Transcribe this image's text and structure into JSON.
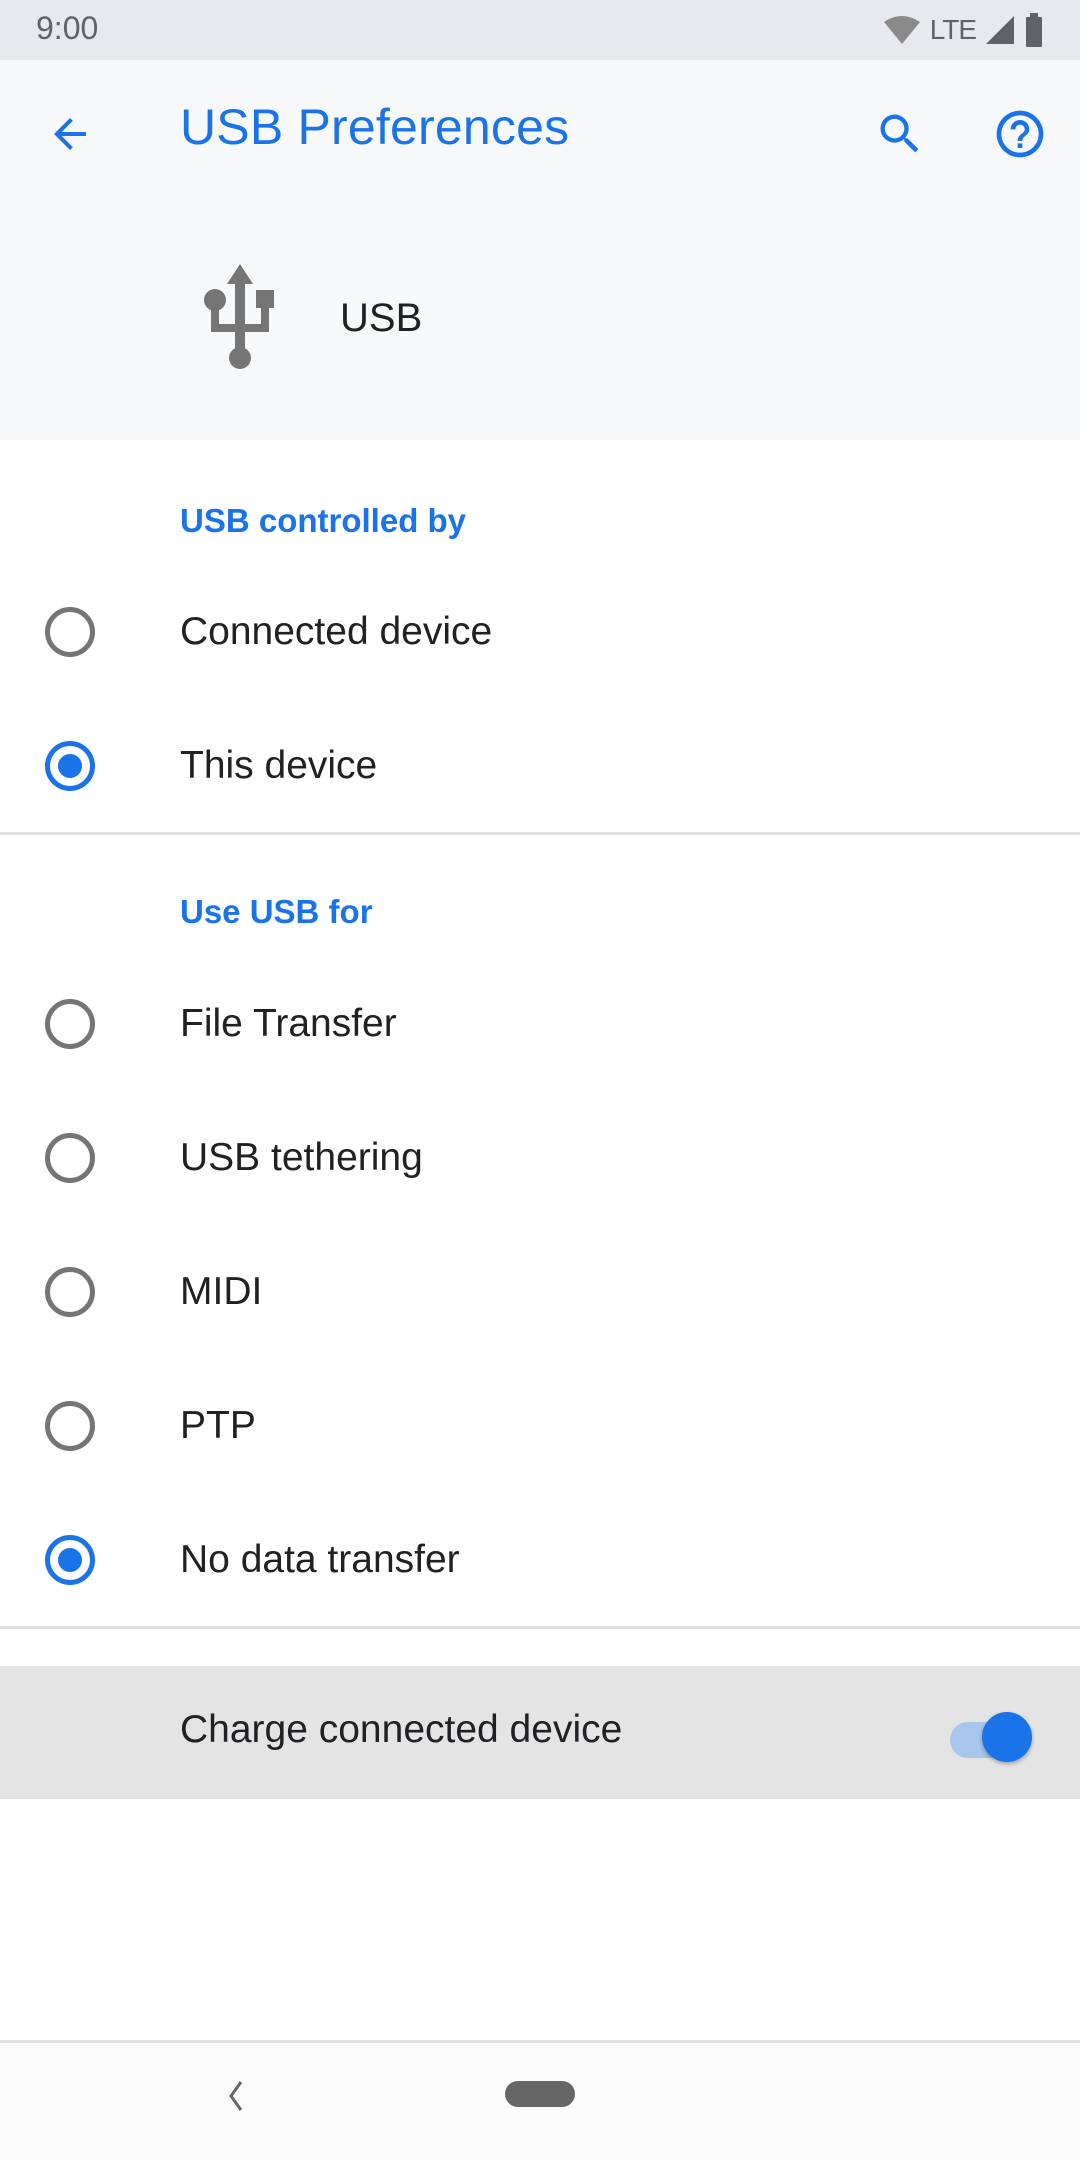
{
  "status_bar": {
    "time": "9:00",
    "network": "LTE",
    "icons": [
      "wifi-icon",
      "lte-text",
      "cell-signal-icon",
      "battery-icon"
    ]
  },
  "app_bar": {
    "title": "USB Preferences",
    "back_icon": "arrow-back-icon",
    "search_icon": "search-icon",
    "help_icon": "help-icon"
  },
  "header": {
    "icon": "usb-icon",
    "label": "USB"
  },
  "sections": [
    {
      "title": "USB controlled by",
      "options": [
        {
          "label": "Connected device",
          "checked": false
        },
        {
          "label": "This device",
          "checked": true
        }
      ]
    },
    {
      "title": "Use USB for",
      "options": [
        {
          "label": "File Transfer",
          "checked": false
        },
        {
          "label": "USB tethering",
          "checked": false
        },
        {
          "label": "MIDI",
          "checked": false
        },
        {
          "label": "PTP",
          "checked": false
        },
        {
          "label": "No data transfer",
          "checked": true
        }
      ]
    }
  ],
  "charge_toggle": {
    "label": "Charge connected device",
    "enabled": true
  },
  "nav_bar": {
    "back_icon": "nav-back-icon",
    "home_icon": "nav-home-pill"
  },
  "colors": {
    "accent": "#1a73e8",
    "text_primary": "#202124",
    "icon_grey": "#757575",
    "status_bar_bg": "#e8e9ec",
    "app_bar_bg": "#f7f8fa",
    "highlight_row_bg": "#e4e4e4"
  }
}
